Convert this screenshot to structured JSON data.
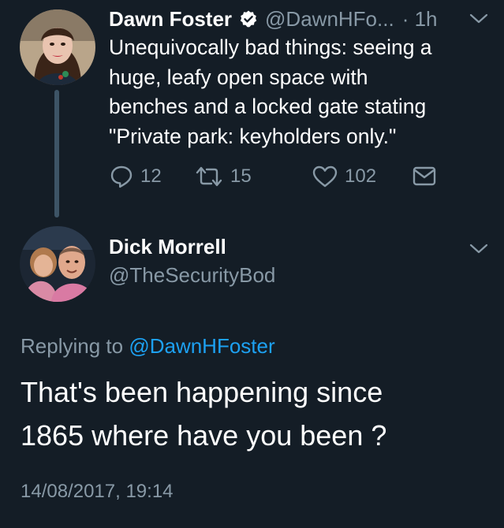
{
  "colors": {
    "background": "#141d26",
    "secondary_text": "#8899a6",
    "link": "#1da1f2",
    "verified": "#ffffff",
    "thread_line": "#3d5466"
  },
  "parent_tweet": {
    "display_name": "Dawn Foster",
    "verified_icon": "verified-badge-icon",
    "handle": "@DawnHFo...",
    "time": "· 1h",
    "text": "Unequivocally bad things: seeing a\nhuge, leafy open space with\nbenches and a locked gate stating\n\"Private park: keyholders only.\"",
    "actions": {
      "reply_count": "12",
      "retweet_count": "15",
      "like_count": "102"
    }
  },
  "main_tweet": {
    "display_name": "Dick Morrell",
    "handle": "@TheSecurityBod",
    "replying_prefix": "Replying to",
    "replying_to": "@DawnHFoster",
    "text": "That's been happening since\n1865 where have you been ?",
    "timestamp": "14/08/2017, 19:14"
  }
}
